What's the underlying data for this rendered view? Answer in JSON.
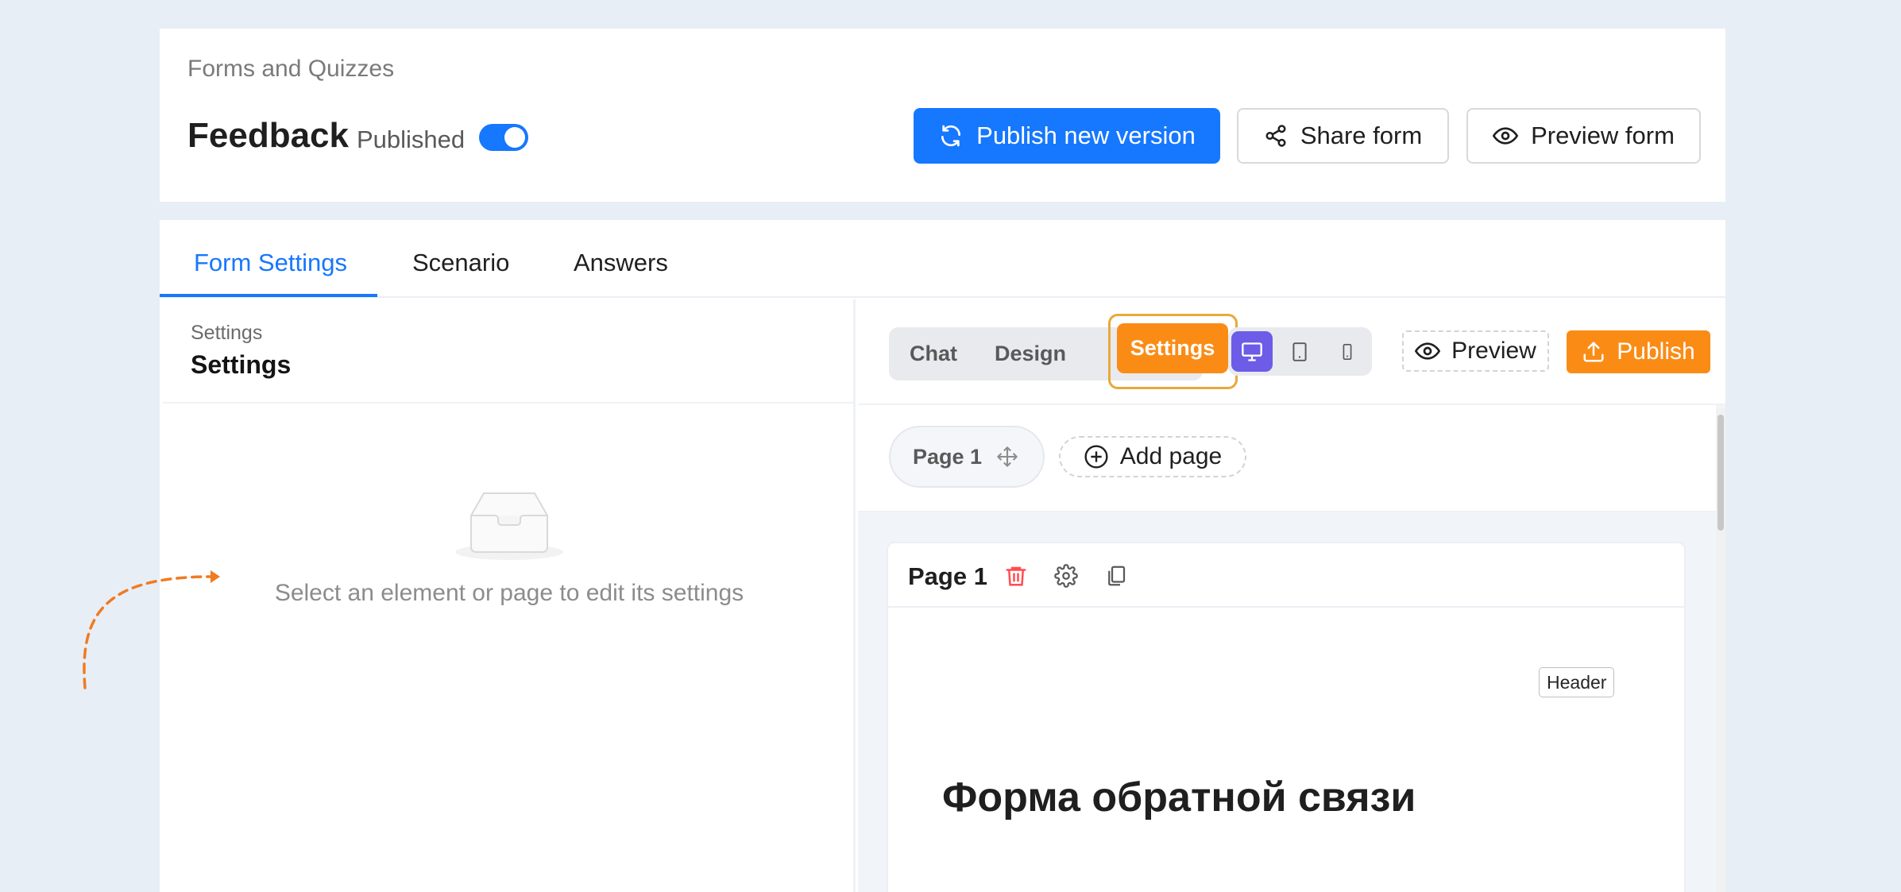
{
  "header": {
    "breadcrumb": "Forms and Quizzes",
    "form_title": "Feedback",
    "status_label": "Published",
    "published_toggle": true,
    "buttons": {
      "publish_new_version": "Publish new version",
      "share_form": "Share form",
      "preview_form": "Preview form"
    }
  },
  "tabs": [
    {
      "label": "Form Settings",
      "active": true
    },
    {
      "label": "Scenario",
      "active": false
    },
    {
      "label": "Answers",
      "active": false
    }
  ],
  "left_panel": {
    "breadcrumb": "Settings",
    "title": "Settings",
    "empty_icon": "inbox-icon",
    "empty_message": "Select an element or page to edit its settings"
  },
  "editor": {
    "mode_tabs": [
      {
        "label": "Chat",
        "active": false
      },
      {
        "label": "Design",
        "active": false
      },
      {
        "label": "Settings",
        "active": true
      }
    ],
    "devices": [
      {
        "icon": "desktop-icon",
        "active": true
      },
      {
        "icon": "tablet-icon",
        "active": false
      },
      {
        "icon": "mobile-icon",
        "active": false
      }
    ],
    "preview_label": "Preview",
    "publish_label": "Publish",
    "pages": [
      {
        "label": "Page 1",
        "icon": "drag-move-icon"
      }
    ],
    "add_page_label": "Add page",
    "page_card": {
      "title": "Page 1",
      "actions": [
        "trash-icon",
        "gear-icon",
        "copy-icon"
      ],
      "block_tag": "Header",
      "heading": "Форма обратной связи"
    }
  },
  "colors": {
    "primary": "#1677ff",
    "accent_orange": "#fa8c16",
    "device_active": "#6c5ce7",
    "danger": "#ff4d4f",
    "background": "#e8eef6"
  }
}
